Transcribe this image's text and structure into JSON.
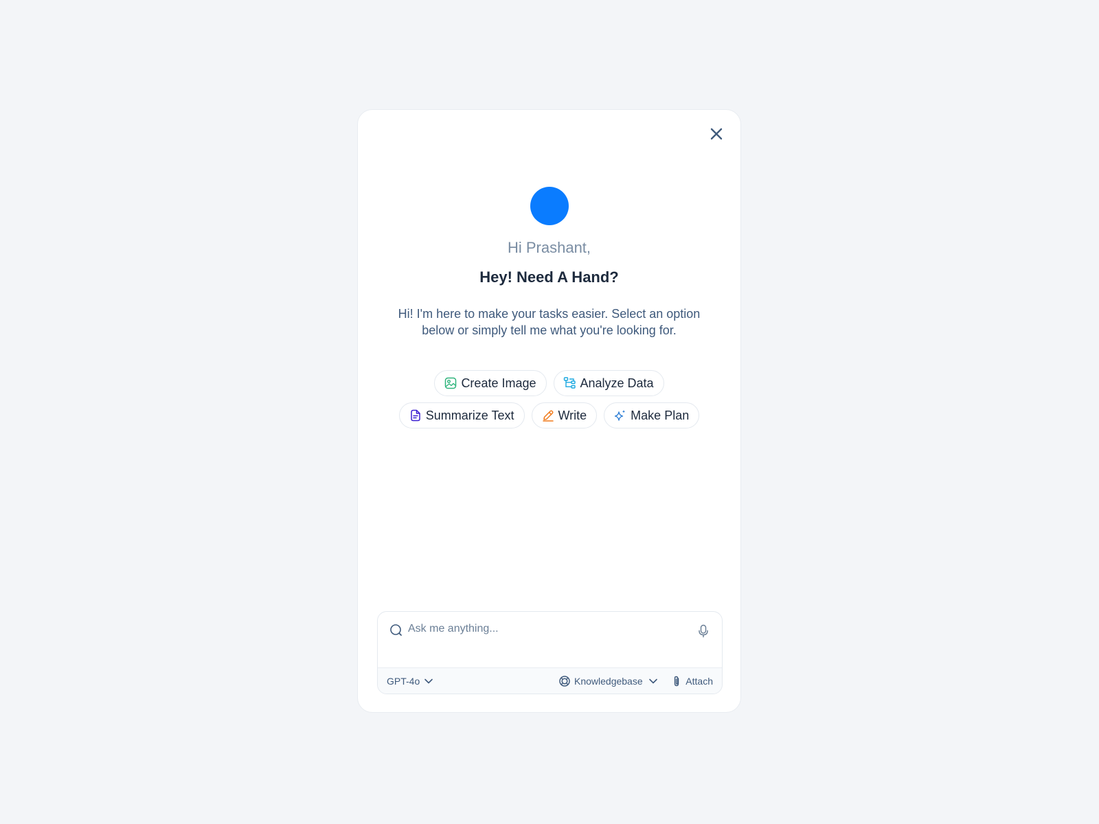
{
  "greeting": "Hi Prashant,",
  "headline": "Hey! Need A Hand?",
  "description": "Hi! I'm here to make your tasks easier. Select an option below or simply tell me what you're looking for.",
  "actions": [
    {
      "label": "Create Image",
      "icon": "image-icon",
      "color": "#2fb47c"
    },
    {
      "label": "Analyze Data",
      "icon": "hierarchy-icon",
      "color": "#1ba8e0"
    },
    {
      "label": "Summarize Text",
      "icon": "document-icon",
      "color": "#3a1fd1"
    },
    {
      "label": "Write",
      "icon": "pen-icon",
      "color": "#f07a1a"
    },
    {
      "label": "Make Plan",
      "icon": "sparkle-icon",
      "color": "#2f7fd6"
    }
  ],
  "composer": {
    "placeholder": "Ask me anything...",
    "model": "GPT-4o",
    "knowledgebase": "Knowledgebase",
    "attach": "Attach"
  },
  "colors": {
    "accent": "#0a7cff",
    "background": "#f3f5f8"
  }
}
